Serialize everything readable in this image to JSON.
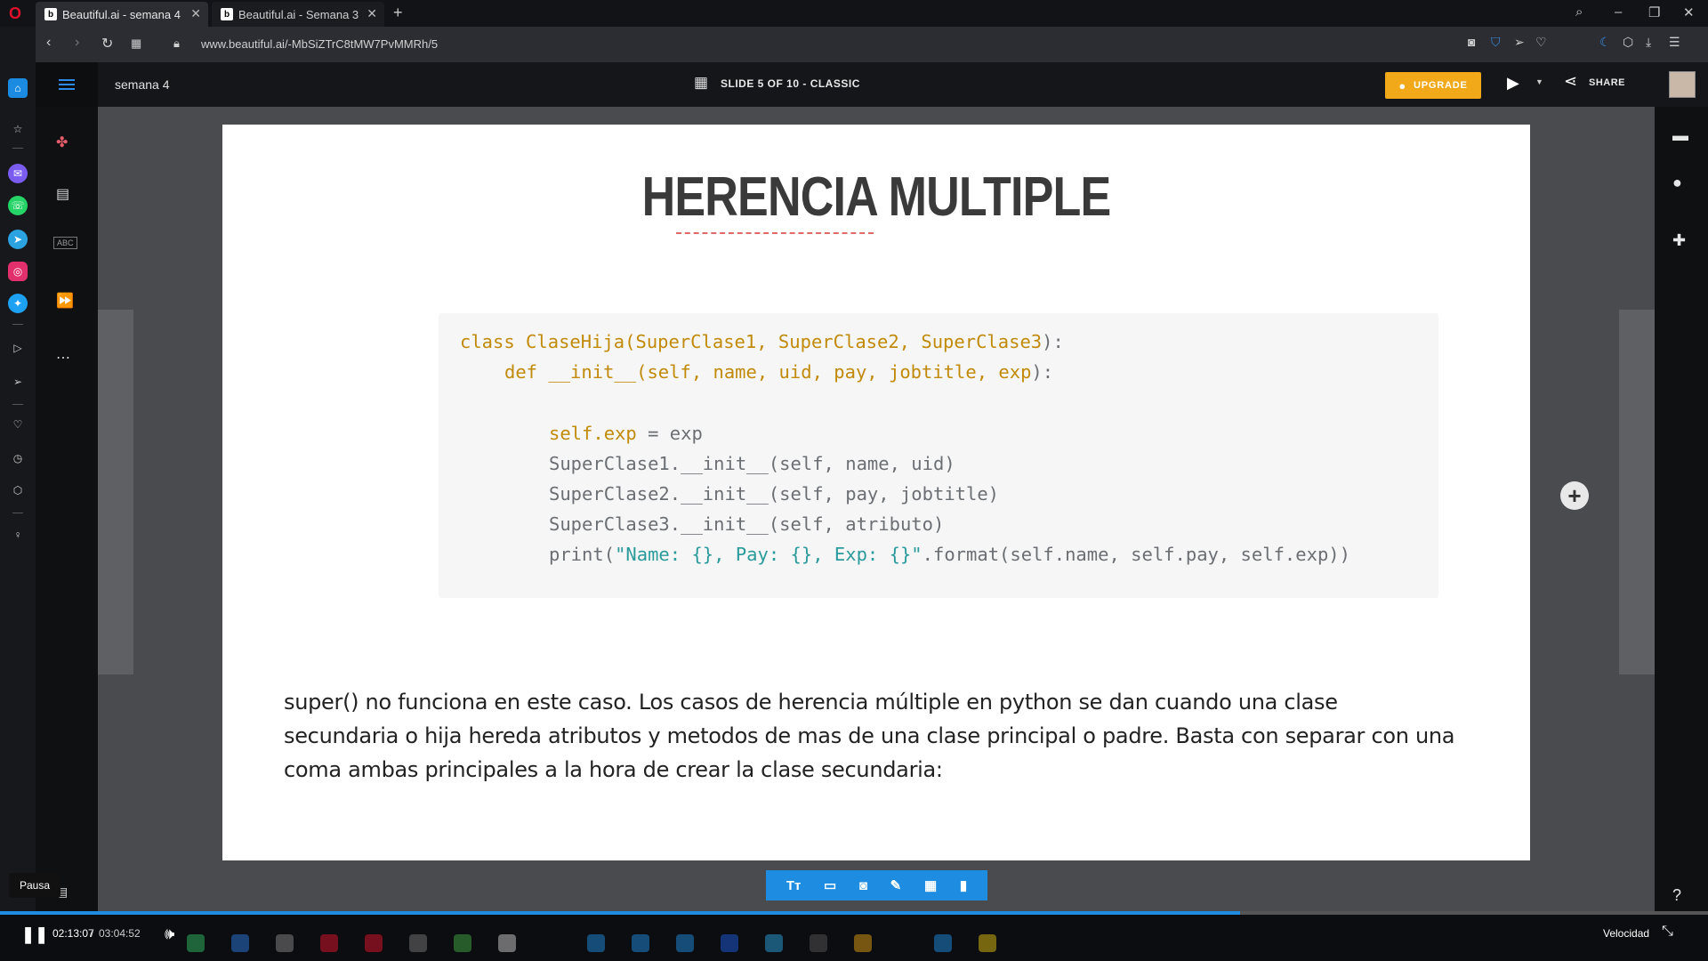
{
  "browser": {
    "tabs": [
      {
        "label": "Beautiful.ai - semana 4",
        "active": true
      },
      {
        "label": "Beautiful.ai - Semana 3",
        "active": false
      }
    ],
    "favicon_letter": "b",
    "url": "www.beautiful.ai/-MbSiZTrC8tMW7PvMMRh/5"
  },
  "app": {
    "doc_title": "semana 4",
    "slide_info": "SLIDE 5 OF 10 - CLASSIC",
    "upgrade_label": "UPGRADE",
    "share_label": "SHARE"
  },
  "slide": {
    "title": "HERENCIA MULTIPLE",
    "code": {
      "line1": {
        "kw": "class ClaseHija(SuperClase1, SuperClase2, SuperClase3",
        "rest": "):"
      },
      "line2": {
        "kw": "def __init__(self, name, uid, pay, jobtitle, exp",
        "rest": "):"
      },
      "line3": {
        "kw": "self.exp",
        "rest": " = exp"
      },
      "line4": "SuperClase1.__init__(self, name, uid)",
      "line5": "SuperClase2.__init__(self, pay, jobtitle)",
      "line6": "SuperClase3.__init__(self, atributo)",
      "line7": {
        "pre": "print(",
        "str": "\"Name: {}, Pay: {}, Exp: {}\"",
        "post": ".format(self.name, self.pay, self.exp))"
      }
    },
    "body": "super() no funciona en este caso. Los casos de herencia múltiple en python se dan cuando una clase secundaria o hija hereda atributos y metodos de mas de una clase principal o padre. Basta con separar con una coma ambas principales a la hora de crear la clase secundaria:"
  },
  "player": {
    "pause_tooltip": "Pausa",
    "time_current": "02:13:07",
    "time_sep": "/",
    "time_total": "03:04:52",
    "speed_label": "Velocidad",
    "progress_fraction": 0.726
  },
  "colors": {
    "accent": "#1e8ce0",
    "upgrade": "#f1a91a",
    "code_keyword": "#c18a08",
    "code_string": "#2a9a9a"
  }
}
